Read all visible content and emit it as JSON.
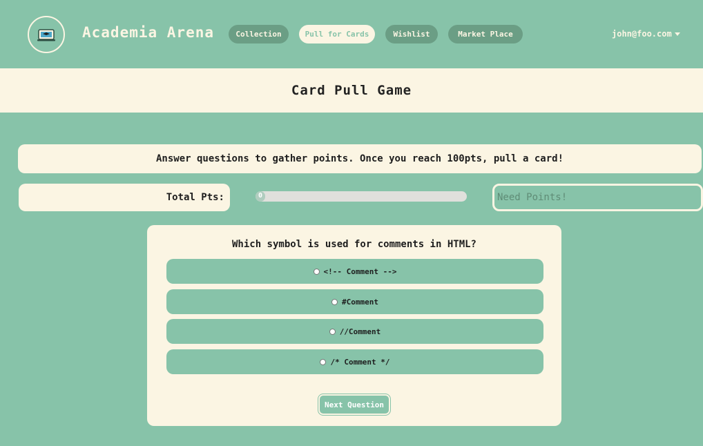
{
  "app": {
    "brand": "Academia Arena",
    "logo_icon": "graduation-laptop-logo-icon"
  },
  "nav": {
    "items": [
      {
        "label": "Collection",
        "active": false
      },
      {
        "label": "Pull for Cards",
        "active": true
      },
      {
        "label": "Wishlist",
        "active": false
      },
      {
        "label": "Market Place",
        "active": false
      }
    ],
    "user_email": "john@foo.com"
  },
  "page": {
    "title": "Card Pull Game",
    "instructions": "Answer questions to gather points. Once you reach 100pts, pull a card!"
  },
  "points": {
    "label": "Total Pts:",
    "progress_label": "0",
    "progress_percent": 0,
    "need_points_placeholder": "Need Points!"
  },
  "quiz": {
    "question": "Which symbol is used for comments in HTML?",
    "options": [
      "<!-- Comment -->",
      "#Comment",
      "//Comment",
      "/* Comment */"
    ],
    "next_label": "Next Question"
  },
  "colors": {
    "background": "#87c3a9",
    "cream": "#fbf5e3",
    "pill_dark": "#6b9e85"
  }
}
